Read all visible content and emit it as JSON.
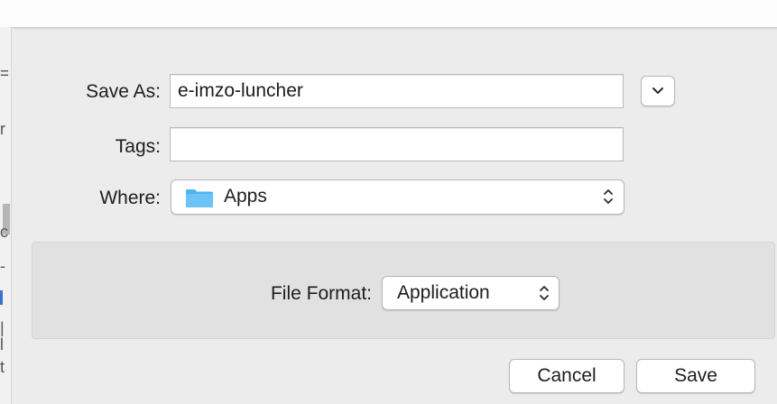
{
  "dialog": {
    "save_as": {
      "label": "Save As:",
      "value": "e-imzo-luncher"
    },
    "tags": {
      "label": "Tags:",
      "value": "",
      "placeholder": ""
    },
    "where": {
      "label": "Where:",
      "value": "Apps",
      "icon": "folder-icon"
    },
    "expand_icon": "chevron-down-icon",
    "format": {
      "label": "File Format:",
      "value": "Application"
    },
    "buttons": {
      "cancel": "Cancel",
      "save": "Save"
    }
  },
  "background_fragments": [
    "=",
    "r",
    "c",
    "-",
    "|",
    "l",
    "t"
  ],
  "colors": {
    "folder": "#4fb3ef",
    "window_bg": "#ececec",
    "panel_bg": "#e1e1e1"
  }
}
